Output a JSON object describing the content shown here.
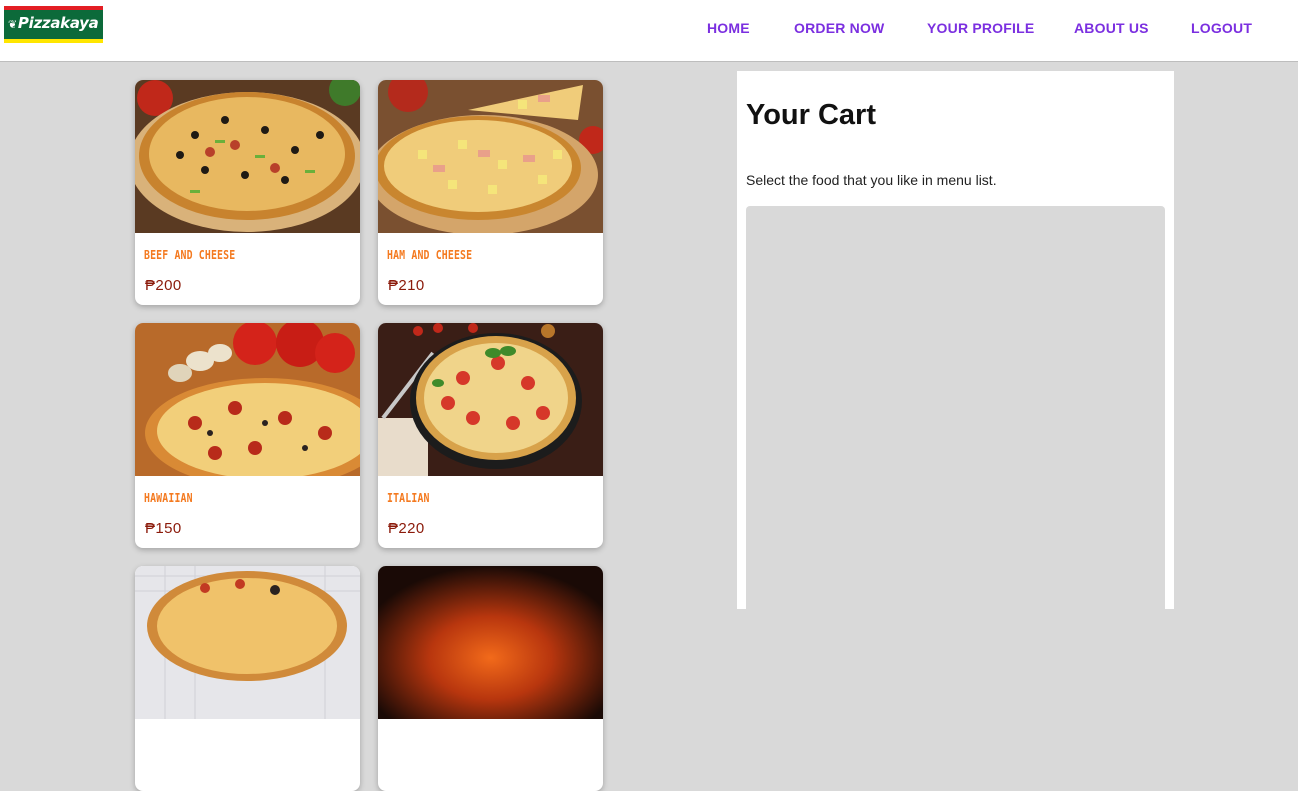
{
  "brand": {
    "logo_text": "Pizzakaya",
    "colors": {
      "green": "#0c6a3a",
      "red": "#e31e24",
      "yellow": "#ffe600"
    }
  },
  "nav": {
    "items": [
      {
        "label": "HOME"
      },
      {
        "label": "ORDER NOW"
      },
      {
        "label": "YOUR PROFILE"
      },
      {
        "label": "ABOUT US"
      },
      {
        "label": "LOGOUT"
      }
    ],
    "color": "#7b2fe0"
  },
  "menu": {
    "items": [
      {
        "name": "Beef and Cheese",
        "price": "₱200"
      },
      {
        "name": "Ham and Cheese",
        "price": "₱210"
      },
      {
        "name": "Hawaiian",
        "price": "₱150"
      },
      {
        "name": "Italian",
        "price": "₱220"
      },
      {
        "name": "",
        "price": ""
      },
      {
        "name": "",
        "price": ""
      }
    ],
    "name_color": "#f47a20",
    "price_color": "#8b1a0a"
  },
  "cart": {
    "title": "Your Cart",
    "hint": "Select the food that you like in menu list."
  }
}
